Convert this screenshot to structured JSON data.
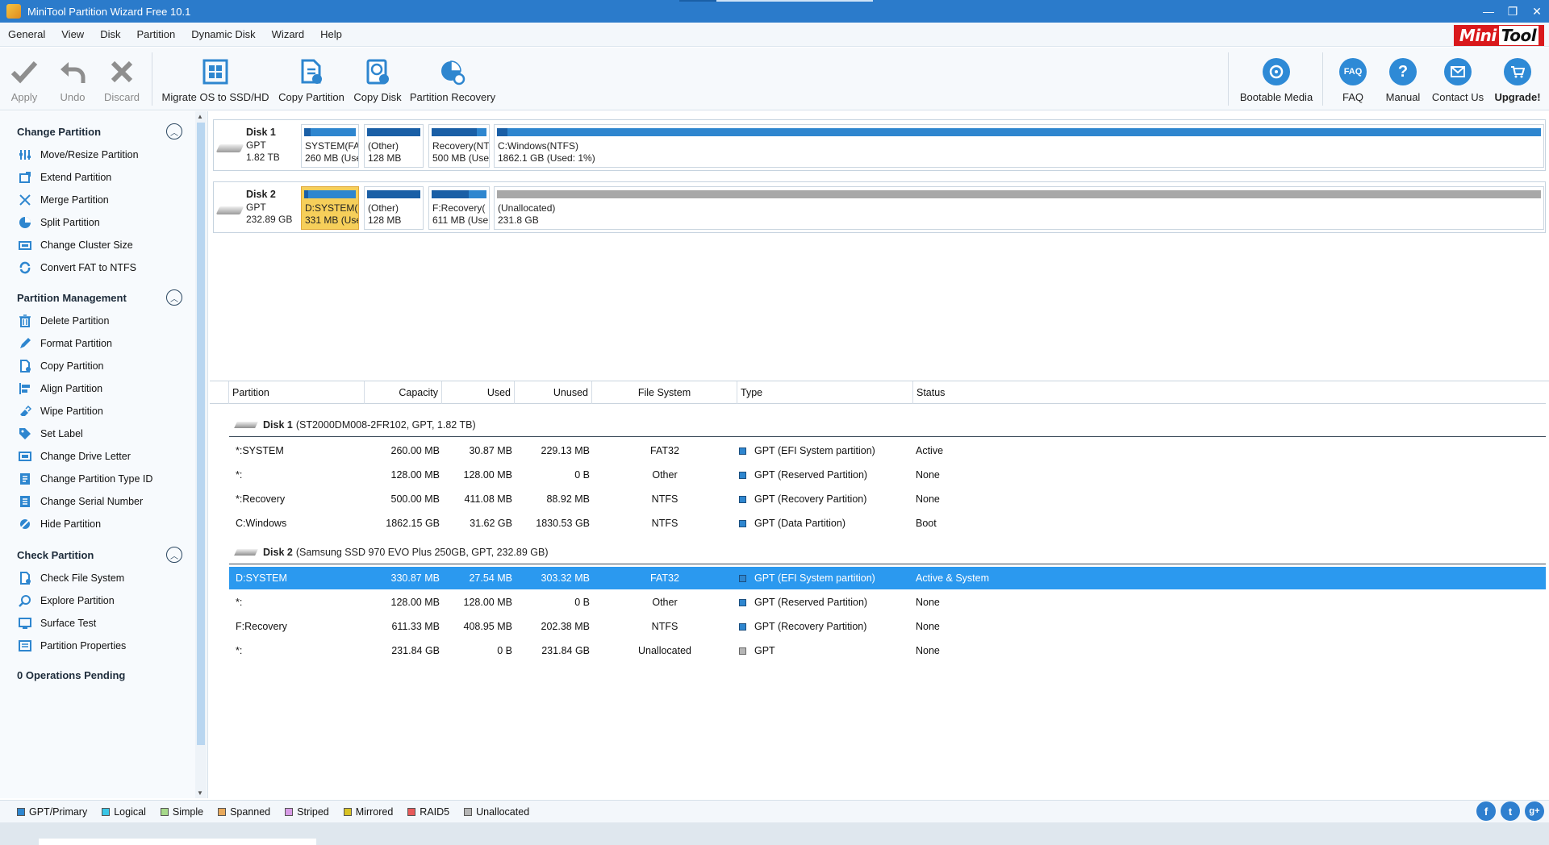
{
  "window": {
    "title": "MiniTool Partition Wizard Free 10.1",
    "controls": [
      "—",
      "❐",
      "✕"
    ]
  },
  "menu": [
    "General",
    "View",
    "Disk",
    "Partition",
    "Dynamic Disk",
    "Wizard",
    "Help"
  ],
  "logo": {
    "mini": "Mini",
    "tool": "Tool"
  },
  "toolbar": {
    "apply": "Apply",
    "undo": "Undo",
    "discard": "Discard",
    "migrate": "Migrate OS to SSD/HD",
    "copy_partition": "Copy Partition",
    "copy_disk": "Copy Disk",
    "partition_recovery": "Partition Recovery",
    "bootable_media": "Bootable Media",
    "faq": "FAQ",
    "faq_icon_text": "FAQ",
    "manual": "Manual",
    "contact_us": "Contact Us",
    "upgrade": "Upgrade!"
  },
  "sidebar": {
    "change_partition": {
      "title": "Change Partition",
      "items": [
        "Move/Resize Partition",
        "Extend Partition",
        "Merge Partition",
        "Split Partition",
        "Change Cluster Size",
        "Convert FAT to NTFS"
      ]
    },
    "partition_management": {
      "title": "Partition Management",
      "items": [
        "Delete Partition",
        "Format Partition",
        "Copy Partition",
        "Align Partition",
        "Wipe Partition",
        "Set Label",
        "Change Drive Letter",
        "Change Partition Type ID",
        "Change Serial Number",
        "Hide Partition"
      ]
    },
    "check_partition": {
      "title": "Check Partition",
      "items": [
        "Check File System",
        "Explore Partition",
        "Surface Test",
        "Partition Properties"
      ]
    },
    "operations_pending": "0 Operations Pending"
  },
  "diskmap": {
    "disk1": {
      "name": "Disk 1",
      "type": "GPT",
      "size": "1.82 TB",
      "partitions": [
        {
          "l1": "SYSTEM(FAT",
          "l2": "260 MB (Use",
          "used_frac": 0.12
        },
        {
          "l1": "(Other)",
          "l2": "128 MB",
          "used_frac": 1.0
        },
        {
          "l1": "Recovery(NT",
          "l2": "500 MB (Use",
          "used_frac": 0.82
        },
        {
          "l1": "C:Windows(NTFS)",
          "l2": "1862.1 GB (Used: 1%)",
          "used_frac": 0.01
        }
      ]
    },
    "disk2": {
      "name": "Disk 2",
      "type": "GPT",
      "size": "232.89 GB",
      "partitions": [
        {
          "l1": "D:SYSTEM(F",
          "l2": "331 MB (Use",
          "used_frac": 0.08
        },
        {
          "l1": "(Other)",
          "l2": "128 MB",
          "used_frac": 1.0
        },
        {
          "l1": "F:Recovery(",
          "l2": "611 MB (Use",
          "used_frac": 0.67
        },
        {
          "l1": "(Unallocated)",
          "l2": "231.8 GB",
          "used_frac": 0
        }
      ]
    }
  },
  "table": {
    "headers": [
      "Partition",
      "Capacity",
      "Used",
      "Unused",
      "File System",
      "Type",
      "Status"
    ],
    "disk1": {
      "name": "Disk 1",
      "detail": "(ST2000DM008-2FR102, GPT, 1.82 TB)"
    },
    "disk1_rows": [
      [
        "*:SYSTEM",
        "260.00 MB",
        "30.87 MB",
        "229.13 MB",
        "FAT32",
        "GPT (EFI System partition)",
        "Active"
      ],
      [
        "*:",
        "128.00 MB",
        "128.00 MB",
        "0 B",
        "Other",
        "GPT (Reserved Partition)",
        "None"
      ],
      [
        "*:Recovery",
        "500.00 MB",
        "411.08 MB",
        "88.92 MB",
        "NTFS",
        "GPT (Recovery Partition)",
        "None"
      ],
      [
        "C:Windows",
        "1862.15 GB",
        "31.62 GB",
        "1830.53 GB",
        "NTFS",
        "GPT (Data Partition)",
        "Boot"
      ]
    ],
    "disk2": {
      "name": "Disk 2",
      "detail": "(Samsung SSD 970 EVO Plus 250GB, GPT, 232.89 GB)"
    },
    "disk2_rows": [
      [
        "D:SYSTEM",
        "330.87 MB",
        "27.54 MB",
        "303.32 MB",
        "FAT32",
        "GPT (EFI System partition)",
        "Active & System"
      ],
      [
        "*:",
        "128.00 MB",
        "128.00 MB",
        "0 B",
        "Other",
        "GPT (Reserved Partition)",
        "None"
      ],
      [
        "F:Recovery",
        "611.33 MB",
        "408.95 MB",
        "202.38 MB",
        "NTFS",
        "GPT (Recovery Partition)",
        "None"
      ],
      [
        "*:",
        "231.84 GB",
        "0 B",
        "231.84 GB",
        "Unallocated",
        "GPT",
        "None"
      ]
    ]
  },
  "legend": [
    {
      "label": "GPT/Primary",
      "color": "#2e86cf"
    },
    {
      "label": "Logical",
      "color": "#39c6e6"
    },
    {
      "label": "Simple",
      "color": "#a6d98a"
    },
    {
      "label": "Spanned",
      "color": "#e8a95c"
    },
    {
      "label": "Striped",
      "color": "#d79be6"
    },
    {
      "label": "Mirrored",
      "color": "#d8c224"
    },
    {
      "label": "RAID5",
      "color": "#e85a5a"
    },
    {
      "label": "Unallocated",
      "color": "#b5b5b5"
    }
  ],
  "social": [
    "f",
    "t",
    "g+"
  ]
}
